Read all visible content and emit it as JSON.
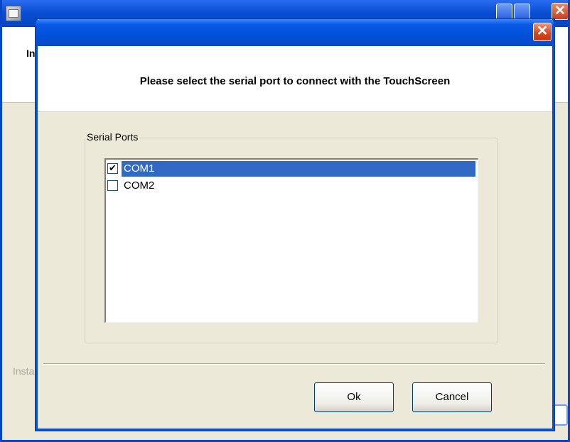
{
  "background_window": {
    "title_fragment": "",
    "header_fragment": "In",
    "footer_fragment": "Insta"
  },
  "dialog": {
    "title": "",
    "close_glyph": "✕",
    "heading": "Please select the serial port to connect with the TouchScreen",
    "group_label": "Serial Ports",
    "ports": [
      {
        "label": "COM1",
        "checked": true,
        "selected": true
      },
      {
        "label": "COM2",
        "checked": false,
        "selected": false
      }
    ],
    "buttons": {
      "ok": "Ok",
      "cancel": "Cancel"
    }
  },
  "colors": {
    "titlebar": "#0a50cf",
    "selection": "#316ac5",
    "face": "#ece9d8",
    "close": "#d5461d"
  },
  "icons": {
    "app": "installer-app-icon",
    "check": "✔"
  }
}
